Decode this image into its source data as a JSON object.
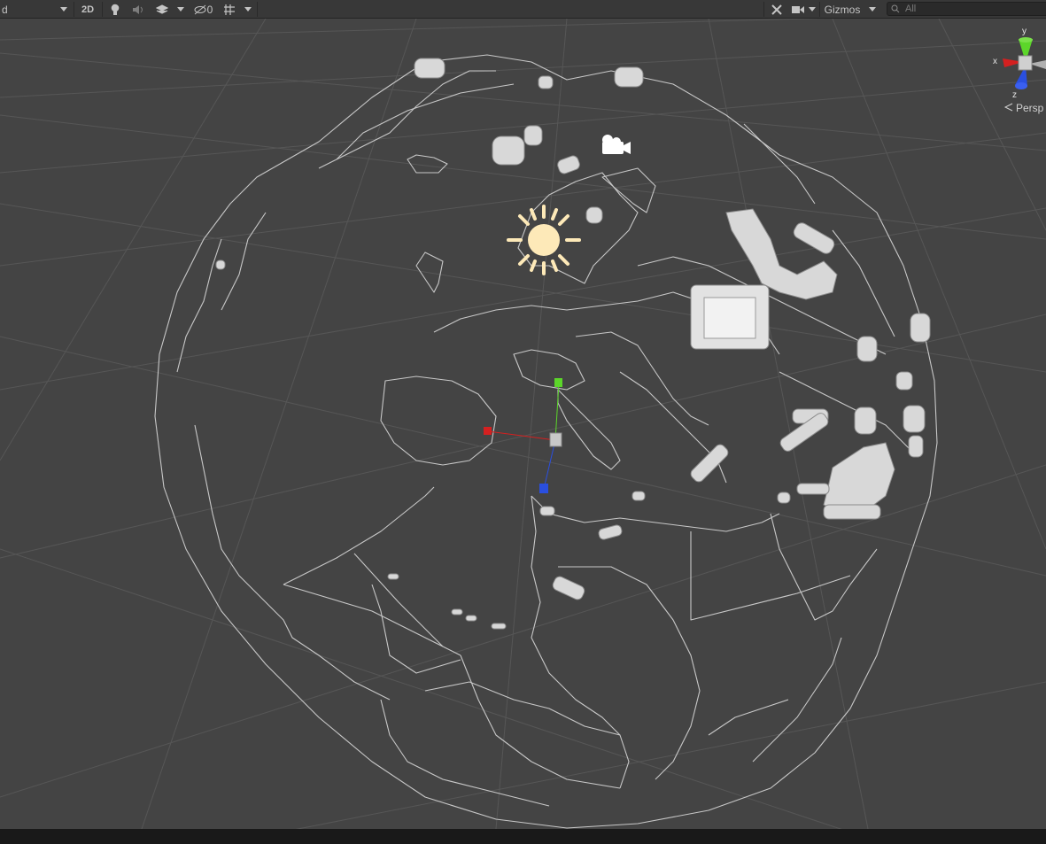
{
  "toolbar": {
    "shading_mode": "d",
    "mode_2d": "2D",
    "hidden_count": "0",
    "gizmos_label": "Gizmos",
    "search_placeholder": "All"
  },
  "scene_gizmo": {
    "x_label": "x",
    "y_label": "y",
    "z_label": "z",
    "projection_label": "Persp"
  },
  "colors": {
    "background": "#444444",
    "grid": "#5a5a5a",
    "outline": "#c8c8c8",
    "x_axis": "#d42020",
    "y_axis": "#5cd62a",
    "z_axis": "#2a4fe0",
    "light_icon": "#fde9b8"
  },
  "icons": [
    "light-icon",
    "camera-icon",
    "transform-handle",
    "scene-orientation-gizmo"
  ]
}
